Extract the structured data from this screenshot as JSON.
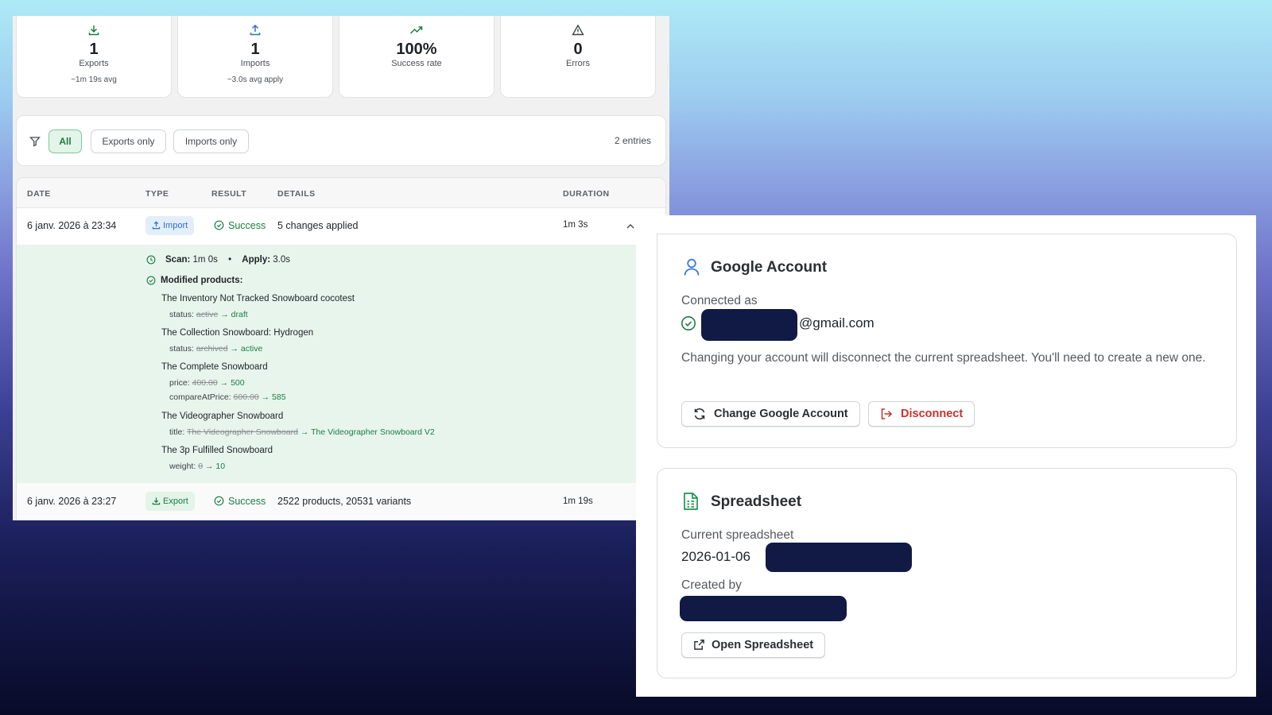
{
  "stats": [
    {
      "icon": "download-icon",
      "value": "1",
      "label": "Exports",
      "sub": "~1m 19s avg"
    },
    {
      "icon": "upload-icon",
      "value": "1",
      "label": "Imports",
      "sub": "~3.0s avg apply"
    },
    {
      "icon": "trending-up-icon",
      "value": "100%",
      "label": "Success rate",
      "sub": ""
    },
    {
      "icon": "warning-icon",
      "value": "0",
      "label": "Errors",
      "sub": ""
    }
  ],
  "filters": {
    "options": [
      "All",
      "Exports only",
      "Imports only"
    ],
    "selected": "All",
    "entries": "2 entries"
  },
  "table": {
    "headers": {
      "date": "DATE",
      "type": "TYPE",
      "result": "RESULT",
      "details": "DETAILS",
      "duration": "DURATION"
    },
    "rows": [
      {
        "date": "6 janv. 2026 à 23:34",
        "type": "Import",
        "result": "Success",
        "details": "5 changes applied",
        "duration": "1m 3s",
        "expanded": true
      },
      {
        "date": "6 janv. 2026 à 23:27",
        "type": "Export",
        "result": "Success",
        "details": "2522 products, 20531 variants",
        "duration": "1m 19s",
        "expanded": false
      }
    ],
    "expanded_details": {
      "scan_label": "Scan:",
      "scan_value": "1m 0s",
      "apply_label": "Apply:",
      "apply_value": "3.0s",
      "modified_label": "Modified products:",
      "products": [
        {
          "name": "The Inventory Not Tracked Snowboard cocotest",
          "changes": [
            {
              "field": "status:",
              "old": "active",
              "new": "draft"
            }
          ]
        },
        {
          "name": "The Collection Snowboard: Hydrogen",
          "changes": [
            {
              "field": "status:",
              "old": "archived",
              "new": "active"
            }
          ]
        },
        {
          "name": "The Complete Snowboard",
          "changes": [
            {
              "field": "price:",
              "old": "400.00",
              "new": "500"
            },
            {
              "field": "compareAtPrice:",
              "old": "600.00",
              "new": "585"
            }
          ]
        },
        {
          "name": "The Videographer Snowboard",
          "changes": [
            {
              "field": "title:",
              "old": "The Videographer Snowboard",
              "new": "The Videographer Snowboard V2"
            }
          ]
        },
        {
          "name": "The 3p Fulfilled Snowboard",
          "changes": [
            {
              "field": "weight:",
              "old": "0",
              "new": "10"
            }
          ]
        }
      ]
    }
  },
  "google_account": {
    "title": "Google Account",
    "connected_label": "Connected as",
    "email_suffix": "@gmail.com",
    "warning": "Changing your account will disconnect the current spreadsheet. You'll need to create a new one.",
    "change_button": "Change Google Account",
    "disconnect_button": "Disconnect"
  },
  "spreadsheet": {
    "title": "Spreadsheet",
    "current_label": "Current spreadsheet",
    "current_prefix": "2026-01-06",
    "created_by_label": "Created by",
    "open_button": "Open Spreadsheet"
  },
  "colors": {
    "success": "#1b7d45",
    "accent_blue": "#2f6fc0",
    "danger": "#c8322f",
    "redaction": "#111a45"
  }
}
